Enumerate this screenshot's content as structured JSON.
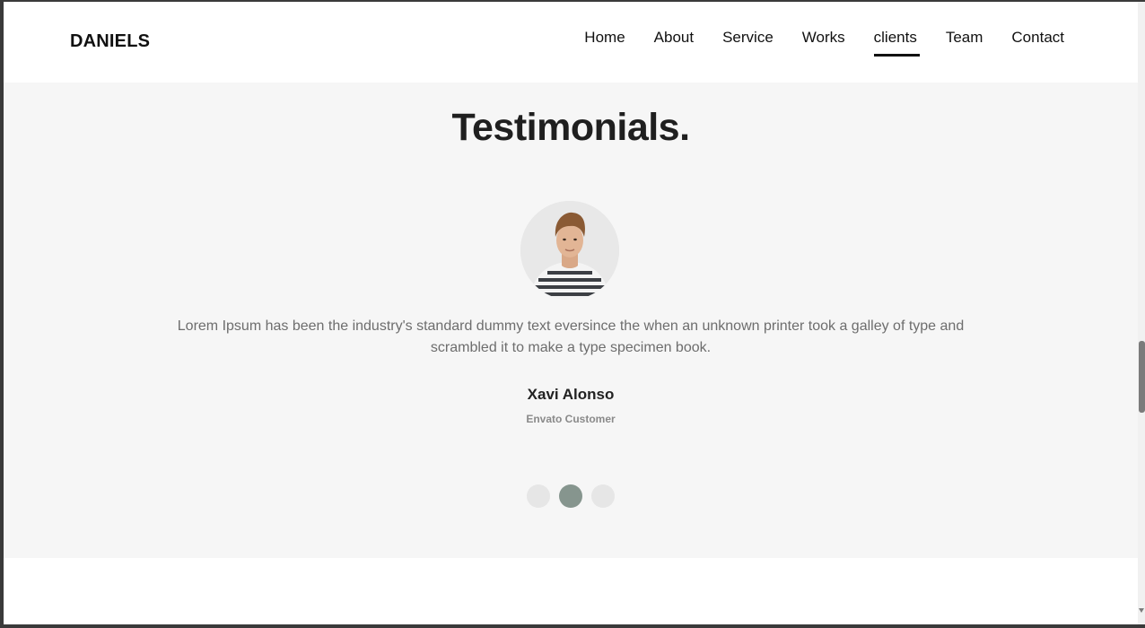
{
  "navbar": {
    "logo": "DANIELS",
    "items": [
      {
        "label": "Home",
        "active": false
      },
      {
        "label": "About",
        "active": false
      },
      {
        "label": "Service",
        "active": false
      },
      {
        "label": "Works",
        "active": false
      },
      {
        "label": "clients",
        "active": true
      },
      {
        "label": "Team",
        "active": false
      },
      {
        "label": "Contact",
        "active": false
      }
    ]
  },
  "testimonials": {
    "title": "Testimonials.",
    "quote": "Lorem Ipsum has been the industry's standard dummy text eversince the when an unknown printer took a galley of type and scrambled it to make a type specimen book.",
    "author_name": "Xavi Alonso",
    "author_role": "Envato Customer",
    "avatar_icon": "person-avatar",
    "slides": 3,
    "active_slide": 2
  },
  "colors": {
    "section_bg": "#f6f6f6",
    "dot_active": "#86958e",
    "dot_inactive": "#e6e6e6",
    "text_dark": "#1f1f1f",
    "text_muted": "#6d6d6d"
  }
}
